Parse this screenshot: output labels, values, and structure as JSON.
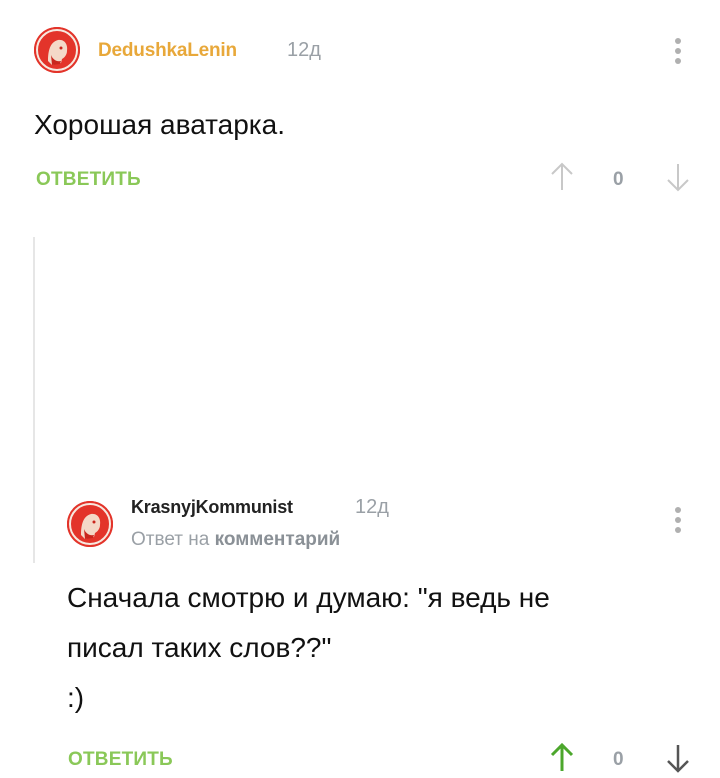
{
  "comments": [
    {
      "username": "DedushkaLenin",
      "time": "12д",
      "text_lines": [
        "Хорошая аватарка."
      ],
      "reply_label": "ОТВЕТИТЬ",
      "score": "0"
    },
    {
      "username": "KrasnyjKommunist",
      "time": "12д",
      "reply_prefix": "Ответ на",
      "reply_target": "комментарий",
      "text_lines": [
        "Сначала смотрю и думаю: \"я ведь не",
        "писал таких слов??\"",
        ":)"
      ],
      "reply_label": "ОТВЕТИТЬ",
      "score": "0"
    }
  ],
  "colors": {
    "accent_green": "#8ac858",
    "username_gold": "#e8a83a",
    "muted": "#9aa0a6",
    "avatar_red": "#e3342a"
  },
  "icons": [
    "lenin-avatar-icon",
    "more-vertical-icon",
    "arrow-up-icon",
    "arrow-down-icon"
  ]
}
